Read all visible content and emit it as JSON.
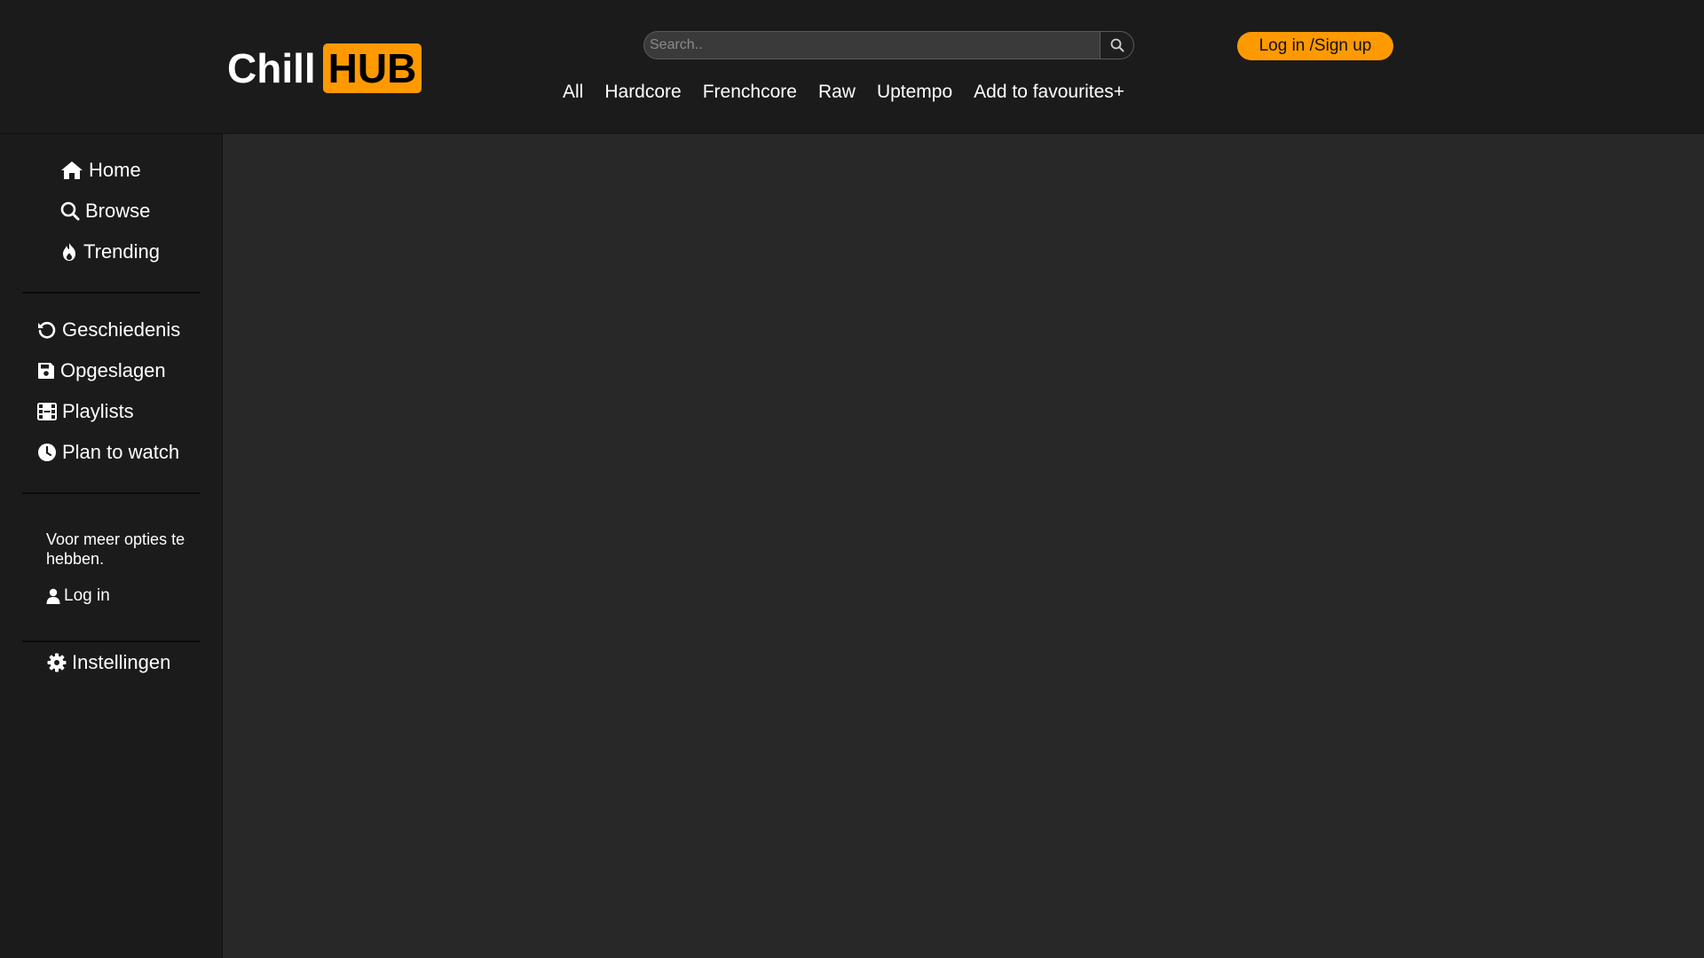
{
  "brand": {
    "name_part1": "Chill",
    "name_part2": "HUB",
    "accent_color": "#ff9900"
  },
  "search": {
    "placeholder": "Search..",
    "value": "",
    "button_icon": "search-icon"
  },
  "header": {
    "login_label": "Log in /Sign up"
  },
  "topnav": {
    "items": [
      "All",
      "Hardcore",
      "Frenchcore",
      "Raw",
      "Uptempo",
      "Add to favourites+"
    ]
  },
  "sidebar": {
    "primary": [
      {
        "label": "Home",
        "icon": "home-icon"
      },
      {
        "label": "Browse",
        "icon": "search-icon"
      },
      {
        "label": "Trending",
        "icon": "fire-icon"
      }
    ],
    "library": [
      {
        "label": "Geschiedenis",
        "icon": "history-icon"
      },
      {
        "label": "Opgeslagen",
        "icon": "save-icon"
      },
      {
        "label": "Playlists",
        "icon": "film-icon"
      },
      {
        "label": "Plan to watch",
        "icon": "clock-icon"
      }
    ],
    "note": "Voor meer opties te hebben.",
    "login_label": "Log in",
    "settings_label": "Instellingen"
  },
  "colors": {
    "header_bg": "#1b1b1b",
    "main_bg": "#282828",
    "text": "#ffffff"
  }
}
